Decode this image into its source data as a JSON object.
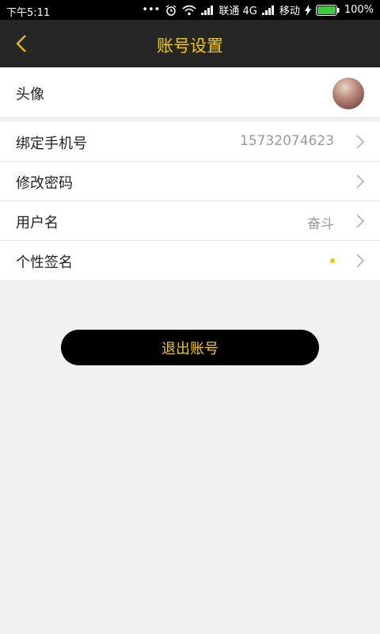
{
  "status_bar": {
    "time": "下午5:11",
    "carrier1": "联通 4G",
    "carrier2": "移动",
    "battery": "100%"
  },
  "header": {
    "title": "账号设置"
  },
  "settings": {
    "avatar_label": "头像",
    "phone_label": "绑定手机号",
    "phone_value": "15732074623",
    "password_label": "修改密码",
    "username_label": "用户名",
    "username_value": "奋斗",
    "signature_label": "个性签名"
  },
  "actions": {
    "logout_label": "退出账号"
  },
  "colors": {
    "accent": "#f5c900",
    "header_bg": "#262626",
    "page_bg": "#f1f1f1"
  }
}
